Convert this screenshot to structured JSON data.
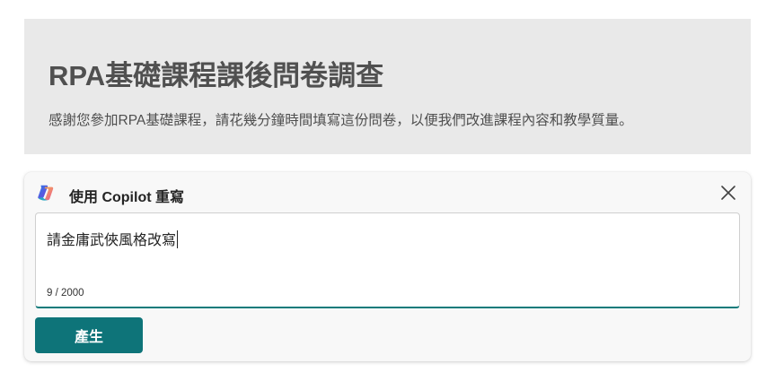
{
  "form": {
    "title": "RPA基礎課程課後問卷調查",
    "description": "感謝您參加RPA基礎課程，請花幾分鐘時間填寫這份問卷，以便我們改進課程內容和教學質量。"
  },
  "copilot": {
    "logo_icon": "copilot-logo-icon",
    "title": "使用 Copilot 重寫",
    "close_icon": "close-icon",
    "prompt_value": "請金庸武俠風格改寫",
    "char_count": "9 / 2000",
    "generate_label": "產生",
    "accent_color": "#0e7479"
  }
}
